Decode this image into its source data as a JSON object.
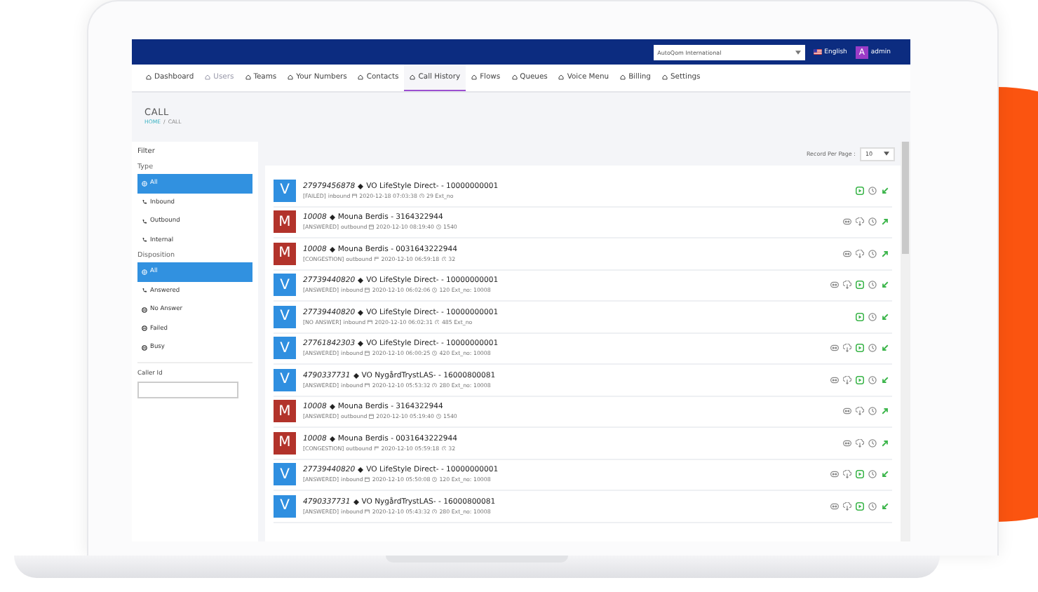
{
  "topbar": {
    "account_select": "AutoQom International",
    "language": "English",
    "avatar": "A",
    "user": "admin"
  },
  "nav": [
    {
      "label": "Dashboard",
      "selected": false,
      "disabled": false
    },
    {
      "label": "Users",
      "selected": false,
      "disabled": true
    },
    {
      "label": "Teams",
      "selected": false,
      "disabled": false
    },
    {
      "label": "Your Numbers",
      "selected": false,
      "disabled": false
    },
    {
      "label": "Contacts",
      "selected": false,
      "disabled": false
    },
    {
      "label": "Call History",
      "selected": true,
      "disabled": false
    },
    {
      "label": "Flows",
      "selected": false,
      "disabled": false
    },
    {
      "label": "Queues",
      "selected": false,
      "disabled": false
    },
    {
      "label": "Voice Menu",
      "selected": false,
      "disabled": false
    },
    {
      "label": "Billing",
      "selected": false,
      "disabled": false
    },
    {
      "label": "Settings",
      "selected": false,
      "disabled": false
    }
  ],
  "page": {
    "title": "CALL",
    "breadcrumb": [
      "HOME",
      "CALL"
    ],
    "separator": "/"
  },
  "filter": {
    "title": "Filter",
    "groups": [
      {
        "title": "Type",
        "options": [
          {
            "label": "All",
            "kind": "globe",
            "selected": true
          },
          {
            "label": "Inbound",
            "kind": "phone",
            "selected": false
          },
          {
            "label": "Outbound",
            "kind": "phone",
            "selected": false
          },
          {
            "label": "Internal",
            "kind": "phone",
            "selected": false
          }
        ]
      },
      {
        "title": "Disposition",
        "options": [
          {
            "label": "All",
            "kind": "globe",
            "selected": true
          },
          {
            "label": "Answered",
            "kind": "phone",
            "selected": false
          },
          {
            "label": "No Answer",
            "kind": "ring",
            "selected": false
          },
          {
            "label": "Failed",
            "kind": "ring",
            "selected": false
          },
          {
            "label": "Busy",
            "kind": "ring",
            "selected": false
          }
        ]
      }
    ],
    "caller_id": {
      "label": "Caller Id"
    }
  },
  "records_per_page": {
    "label": "Record Per Page :",
    "value": "10"
  },
  "calls": [
    {
      "letter": "V",
      "color": "#2f8fe0",
      "number": "27979456878",
      "name": "VO LifeStyle Direct- - 10000000001",
      "status": "[FAILED]",
      "direction": "inbound",
      "date": "2020-12-18 07:03:38",
      "duration": "29 Ext_no",
      "recorded": false,
      "playable": true
    },
    {
      "letter": "M",
      "color": "#b2332b",
      "number": "10008",
      "name": "Mouna Berdis - 3164322944",
      "status": "[ANSWERED]",
      "direction": "outbound",
      "date": "2020-12-10 08:19:40",
      "duration": "1540",
      "recorded": true,
      "playable": false
    },
    {
      "letter": "M",
      "color": "#b2332b",
      "number": "10008",
      "name": "Mouna Berdis - 0031643222944",
      "status": "[CONGESTION]",
      "direction": "outbound",
      "date": "2020-12-10 06:59:18",
      "duration": "32",
      "recorded": true,
      "playable": false
    },
    {
      "letter": "V",
      "color": "#2f8fe0",
      "number": "27739440820",
      "name": "VO LifeStyle Direct- - 10000000001",
      "status": "[ANSWERED]",
      "direction": "inbound",
      "date": "2020-12-10 06:02:06",
      "duration": "120 Ext_no: 10008",
      "recorded": true,
      "playable": true
    },
    {
      "letter": "V",
      "color": "#2f8fe0",
      "number": "27739440820",
      "name": "VO LifeStyle Direct- - 10000000001",
      "status": "[NO ANSWER]",
      "direction": "inbound",
      "date": "2020-12-10 06:02:31",
      "duration": "485 Ext_no",
      "recorded": false,
      "playable": true
    },
    {
      "letter": "V",
      "color": "#2f8fe0",
      "number": "27761842303",
      "name": "VO LifeStyle Direct- - 10000000001",
      "status": "[ANSWERED]",
      "direction": "inbound",
      "date": "2020-12-10 06:00:25",
      "duration": "420 Ext_no: 10008",
      "recorded": true,
      "playable": true
    },
    {
      "letter": "V",
      "color": "#2f8fe0",
      "number": "4790337731",
      "name": "VO NygårdTrystLAS- - 16000800081",
      "status": "[ANSWERED]",
      "direction": "inbound",
      "date": "2020-12-10 05:53:32",
      "duration": "280 Ext_no: 10008",
      "recorded": true,
      "playable": true
    },
    {
      "letter": "M",
      "color": "#b2332b",
      "number": "10008",
      "name": "Mouna Berdis - 3164322944",
      "status": "[ANSWERED]",
      "direction": "outbound",
      "date": "2020-12-10 05:19:40",
      "duration": "1540",
      "recorded": true,
      "playable": false
    },
    {
      "letter": "M",
      "color": "#b2332b",
      "number": "10008",
      "name": "Mouna Berdis - 0031643222944",
      "status": "[CONGESTION]",
      "direction": "outbound",
      "date": "2020-12-10 05:59:18",
      "duration": "32",
      "recorded": true,
      "playable": false
    },
    {
      "letter": "V",
      "color": "#2f8fe0",
      "number": "27739440820",
      "name": "VO LifeStyle Direct- - 10000000001",
      "status": "[ANSWERED]",
      "direction": "inbound",
      "date": "2020-12-10 05:50:08",
      "duration": "120 Ext_no: 10008",
      "recorded": true,
      "playable": true
    },
    {
      "letter": "V",
      "color": "#2f8fe0",
      "number": "4790337731",
      "name": "VO NygårdTrystLAS- - 16000800081",
      "status": "[ANSWERED]",
      "direction": "inbound",
      "date": "2020-12-10 05:43:32",
      "duration": "280 Ext_no: 10008",
      "recorded": true,
      "playable": true
    }
  ]
}
